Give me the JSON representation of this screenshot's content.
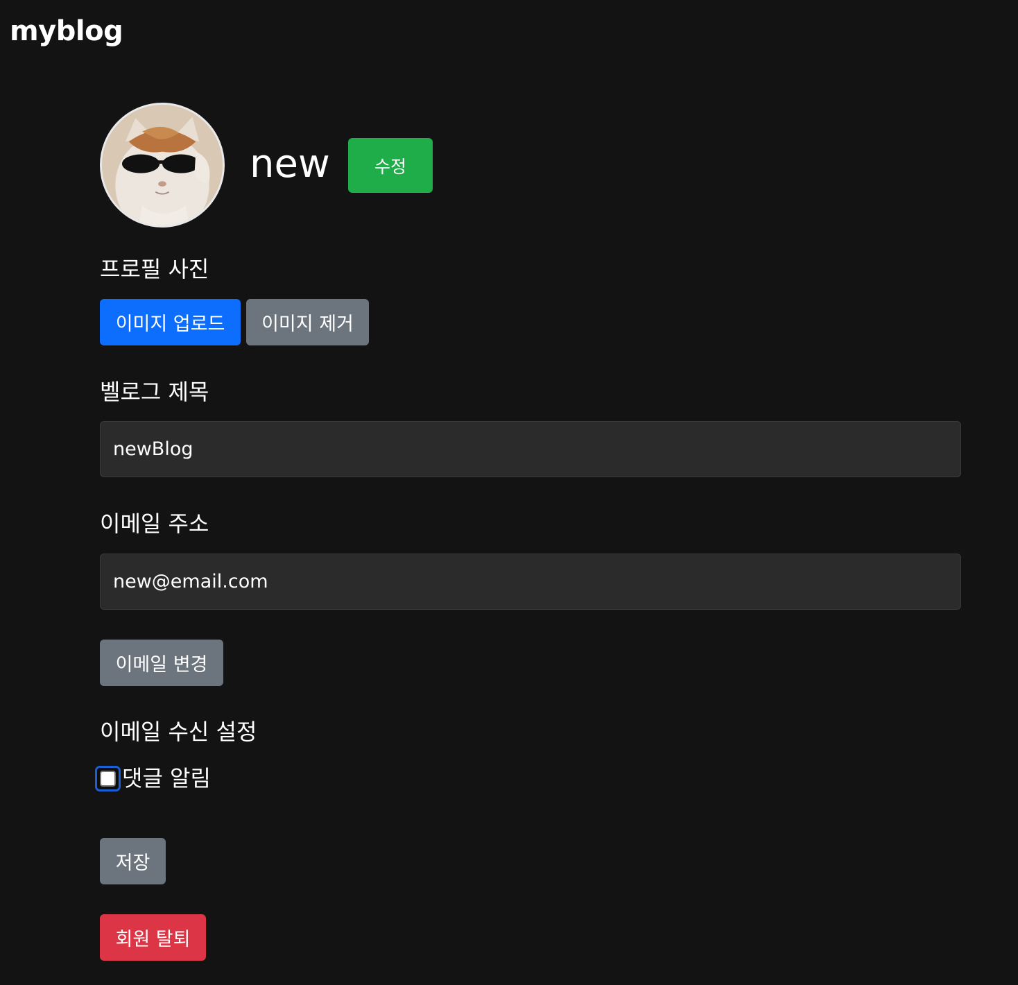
{
  "app": {
    "logo": "myblog"
  },
  "profile": {
    "username": "new",
    "edit_label": "수정",
    "avatar_icon": "cat-with-sunglasses-avatar"
  },
  "photo_section": {
    "label": "프로필 사진",
    "upload_label": "이미지 업로드",
    "remove_label": "이미지 제거"
  },
  "blog_title": {
    "label": "벨로그 제목",
    "value": "newBlog"
  },
  "email": {
    "label": "이메일 주소",
    "value": "new@email.com",
    "change_label": "이메일 변경"
  },
  "notifications": {
    "label": "이메일 수신 설정",
    "comment_alert_label": "댓글 알림",
    "comment_alert_checked": false
  },
  "actions": {
    "save_label": "저장",
    "withdraw_label": "회원 탈퇴"
  },
  "colors": {
    "background": "#131313",
    "edit": "#1fad4a",
    "primary": "#0d6efd",
    "secondary": "#6c757d",
    "danger": "#dc3545"
  }
}
